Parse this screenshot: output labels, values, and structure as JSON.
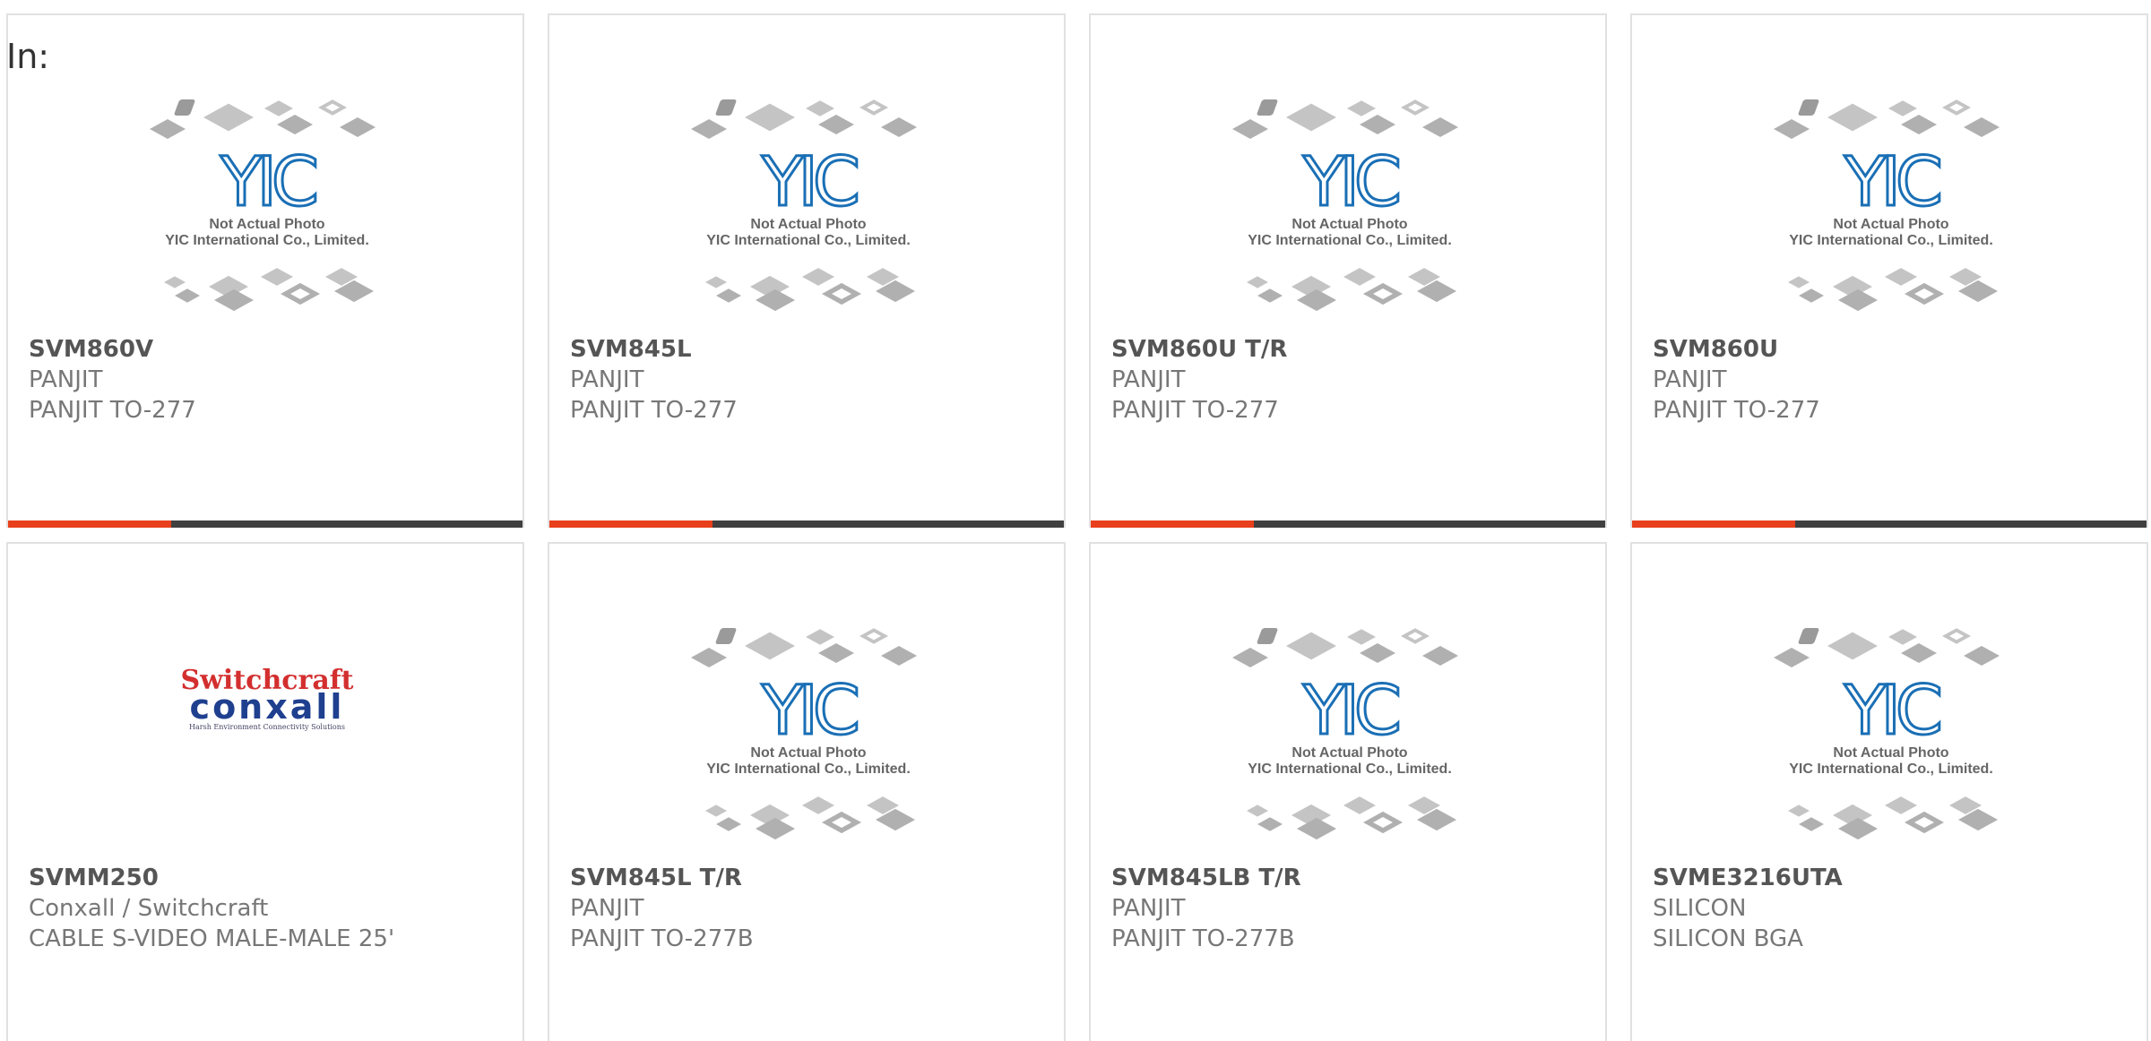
{
  "header": {
    "label": "In:"
  },
  "placeholder": {
    "line1": "Not Actual Photo",
    "line2": "YIC International Co., Limited.",
    "logo_text": "YIC"
  },
  "brand_logo": {
    "line1": "Switchcraft",
    "line2": "conxall",
    "tagline": "Harsh Environment Connectivity Solutions"
  },
  "colors": {
    "accent": "#e8401c",
    "bar": "#404040",
    "logo_blue": "#1a6fb5",
    "switchcraft_red": "#d32f2f",
    "conxall_blue": "#1f3f8f"
  },
  "products": [
    {
      "part": "SVM860V",
      "manufacturer": "PANJIT",
      "description": "PANJIT TO-277",
      "image": "placeholder"
    },
    {
      "part": "SVM845L",
      "manufacturer": "PANJIT",
      "description": "PANJIT TO-277",
      "image": "placeholder"
    },
    {
      "part": "SVM860U T/R",
      "manufacturer": "PANJIT",
      "description": "PANJIT TO-277",
      "image": "placeholder"
    },
    {
      "part": "SVM860U",
      "manufacturer": "PANJIT",
      "description": "PANJIT TO-277",
      "image": "placeholder"
    },
    {
      "part": "SVMM250",
      "manufacturer": "Conxall / Switchcraft",
      "description": "CABLE S-VIDEO MALE-MALE 25'",
      "image": "brand-logo"
    },
    {
      "part": "SVM845L T/R",
      "manufacturer": "PANJIT",
      "description": "PANJIT TO-277B",
      "image": "placeholder"
    },
    {
      "part": "SVM845LB T/R",
      "manufacturer": "PANJIT",
      "description": "PANJIT TO-277B",
      "image": "placeholder"
    },
    {
      "part": "SVME3216UTA",
      "manufacturer": "SILICON",
      "description": "SILICON BGA",
      "image": "placeholder"
    }
  ]
}
